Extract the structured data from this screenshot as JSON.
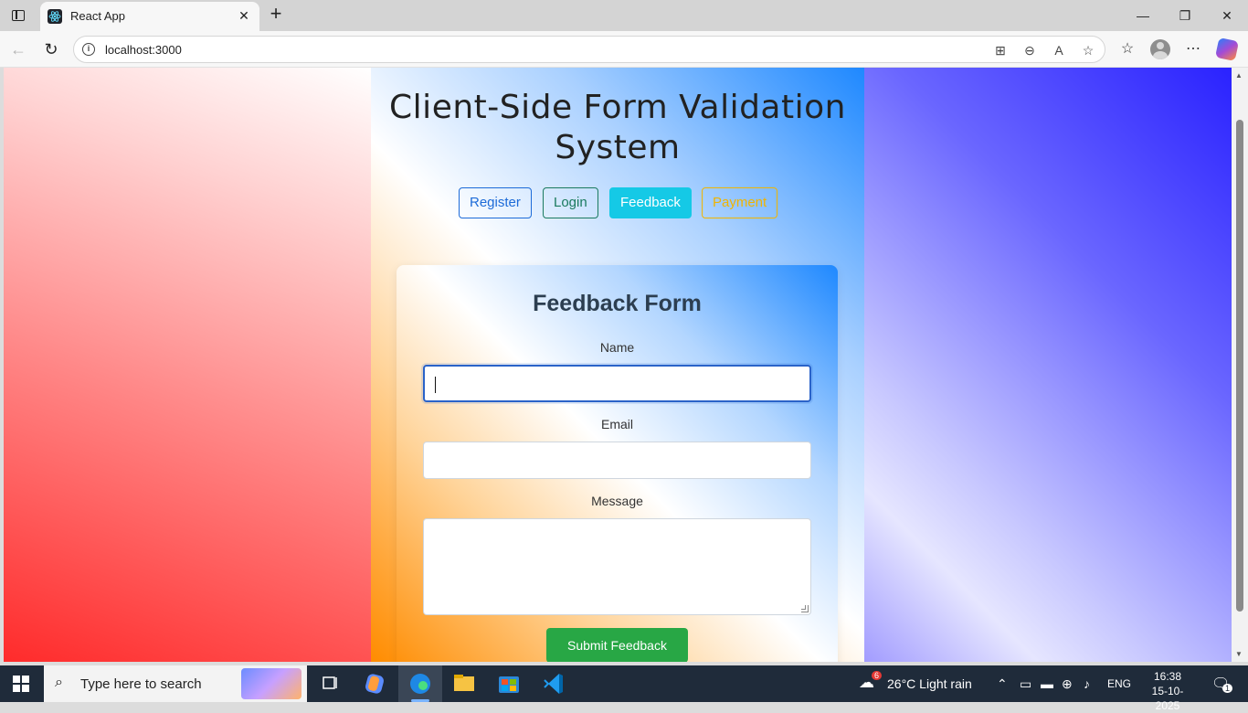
{
  "browser": {
    "tab_title": "React App",
    "url": "localhost:3000"
  },
  "app": {
    "title": "Client-Side Form Validation System",
    "nav": {
      "register": "Register",
      "login": "Login",
      "feedback": "Feedback",
      "payment": "Payment"
    },
    "active_nav": "Feedback"
  },
  "form": {
    "title": "Feedback Form",
    "name_label": "Name",
    "name_value": "",
    "email_label": "Email",
    "email_value": "",
    "message_label": "Message",
    "message_value": "",
    "submit_label": "Submit Feedback"
  },
  "taskbar": {
    "search_placeholder": "Type here to search",
    "weather": "26°C  Light rain",
    "weather_badge": "6",
    "language": "ENG",
    "time": "16:38",
    "date": "15-10-2025",
    "notifications": "1"
  },
  "colors": {
    "register": "#1d6bd8",
    "login": "#1a7a5e",
    "feedback": "#15c9e6",
    "payment": "#f0b400",
    "submit": "#28a745"
  }
}
